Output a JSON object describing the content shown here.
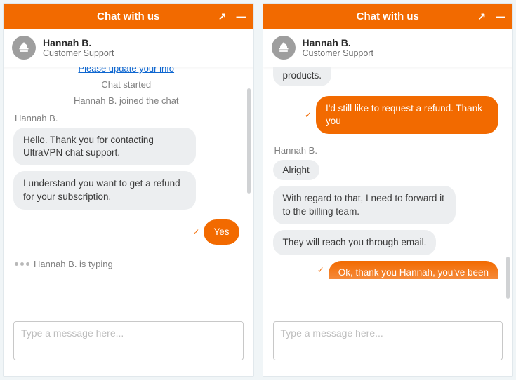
{
  "header": {
    "title": "Chat with us",
    "popout_icon": "↗",
    "minimize_icon": "—"
  },
  "agent": {
    "name": "Hannah B.",
    "role": "Customer Support"
  },
  "left": {
    "update_link": "Please update your info",
    "chat_started": "Chat started",
    "joined": "Hannah B. joined the chat",
    "sender": "Hannah B.",
    "msg1": "Hello. Thank you for contacting UltraVPN chat support.",
    "msg2": "I understand you want to get a refund for your subscription.",
    "reply1": "Yes",
    "typing": "Hannah B. is typing"
  },
  "right": {
    "partial_top": "products.",
    "reply1": "I'd still like to request a refund. Thank you",
    "sender": "Hannah B.",
    "msg1": "Alright",
    "msg2": "With regard to that, I need to forward it to the billing team.",
    "msg3": "They will reach you through email.",
    "reply2": "Ok, thank you Hannah, you've been"
  },
  "input": {
    "placeholder": "Type a message here..."
  }
}
